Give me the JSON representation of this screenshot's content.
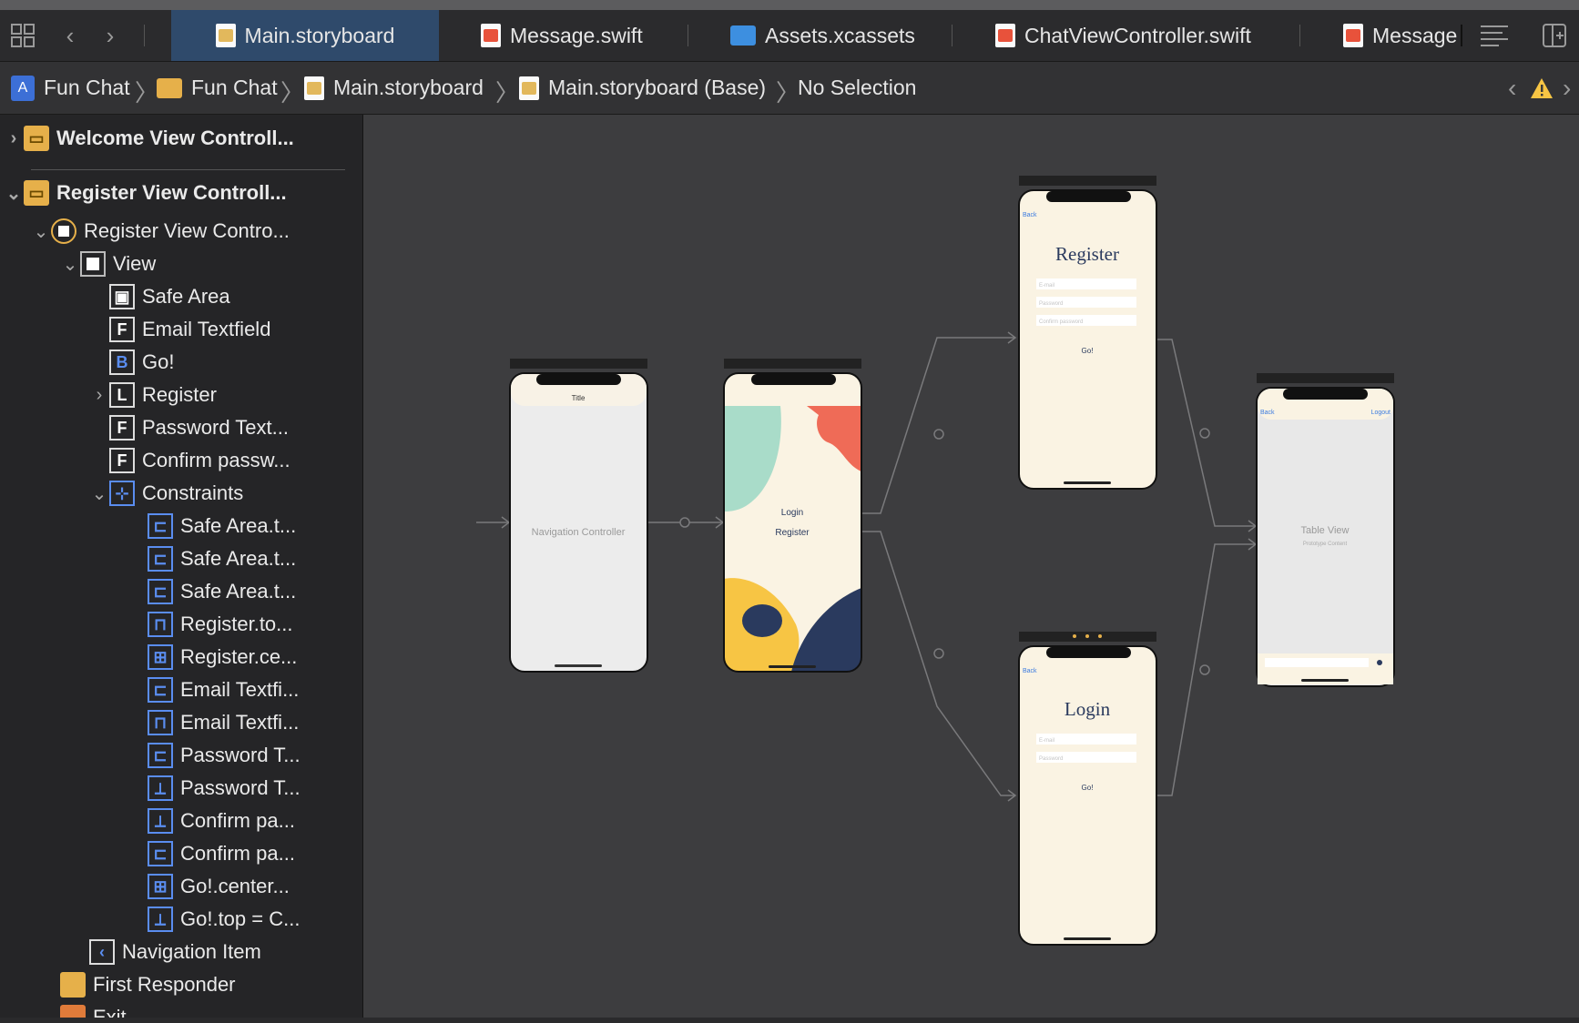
{
  "tabs": [
    {
      "label": "Main.storyboard",
      "icon": "storyboard-file-icon",
      "active": true
    },
    {
      "label": "Message.swift",
      "icon": "swift-file-icon",
      "active": false
    },
    {
      "label": "Assets.xcassets",
      "icon": "assets-folder-icon",
      "active": false
    },
    {
      "label": "ChatViewController.swift",
      "icon": "swift-file-icon",
      "active": false
    },
    {
      "label": "Message",
      "icon": "swift-file-icon",
      "active": false
    }
  ],
  "breadcrumb": {
    "project": "Fun Chat",
    "group": "Fun Chat",
    "file": "Main.storyboard",
    "base": "Main.storyboard (Base)",
    "selection": "No Selection"
  },
  "outline": {
    "welcome_scene": "Welcome View Controll...",
    "register_scene": "Register View Controll...",
    "register_vc": "Register View Contro...",
    "view": "View",
    "safe_area": "Safe Area",
    "email_textfield": "Email Textfield",
    "go": "Go!",
    "register_label": "Register",
    "password_textfield": "Password Text...",
    "confirm_password": "Confirm passw...",
    "constraints": "Constraints",
    "constraint_items": [
      "Safe Area.t...",
      "Safe Area.t...",
      "Safe Area.t...",
      "Register.to...",
      "Register.ce...",
      "Email Textfi...",
      "Email Textfi...",
      "Password T...",
      "Password T...",
      "Confirm pa...",
      "Confirm pa...",
      "Go!.center...",
      "Go!.top = C..."
    ],
    "navigation_item": "Navigation Item",
    "first_responder": "First Responder",
    "exit": "Exit"
  },
  "canvas": {
    "nav_controller": {
      "title": "Title",
      "body": "Navigation Controller"
    },
    "welcome": {
      "login": "Login",
      "register": "Register"
    },
    "register_screen": {
      "back": "Back",
      "title": "Register",
      "email_ph": "E-mail",
      "password_ph": "Password",
      "confirm_ph": "Confirm password",
      "go": "Go!"
    },
    "login_screen": {
      "back": "Back",
      "title": "Login",
      "email_ph": "E-mail",
      "password_ph": "Password",
      "go": "Go!"
    },
    "chat_screen": {
      "back": "Back",
      "logout": "Logout",
      "table_title": "Table View",
      "table_sub": "Prototype Content"
    }
  },
  "colors": {
    "accent": "#2f4a6b",
    "cream": "#faf3e3",
    "navy": "#2a3a5e",
    "teal": "#a9dcc9",
    "coral": "#ef6b57",
    "yellow": "#f7c544",
    "warning": "#f7c544"
  }
}
